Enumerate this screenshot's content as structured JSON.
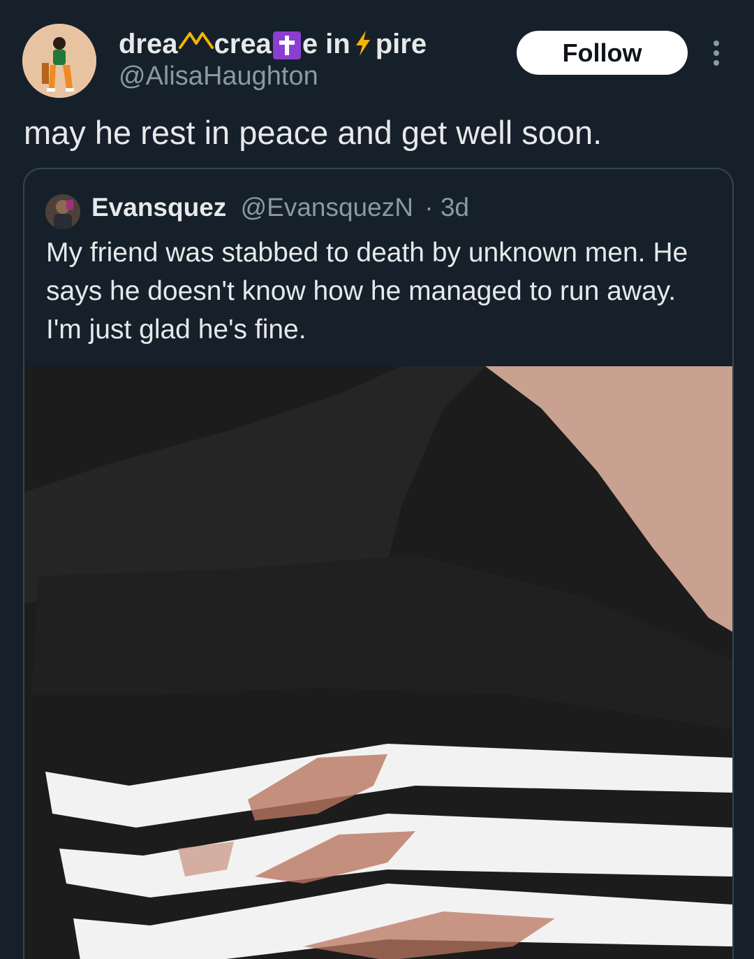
{
  "author": {
    "display_name_part1": "drea",
    "display_name_part2": "crea",
    "display_name_part3": "e in",
    "display_name_part4": "pire",
    "handle": "@AlisaHaughton",
    "follow_label": "Follow"
  },
  "tweet": {
    "text": "may he rest in peace and get well soon."
  },
  "quoted": {
    "name": "Evansquez",
    "handle": "@EvansquezN",
    "time": "· 3d",
    "text": "My friend was stabbed to death by unknown men. He says he doesn't know how he managed to run away. I'm just glad he's fine."
  },
  "colors": {
    "background": "#15202b",
    "text_primary": "#e7e9ea",
    "text_secondary": "#8b98a5",
    "border": "#38444d",
    "accent_cross": "#8b3fd1",
    "lightning": "#f4b400"
  },
  "icons": {
    "more": "more-vertical-icon",
    "crown": "crown-icon",
    "cross": "latin-cross-icon",
    "lightning": "lightning-icon"
  }
}
